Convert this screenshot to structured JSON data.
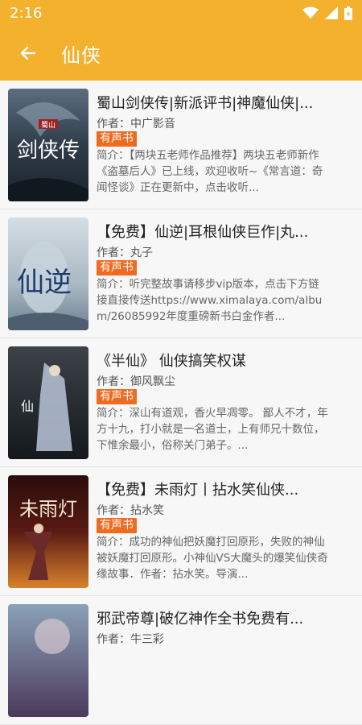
{
  "status": {
    "time": "2:16"
  },
  "header": {
    "title": "仙侠"
  },
  "badge_label": "有声书",
  "items": [
    {
      "title": "蜀山剑侠传|新派评书|神魔仙侠|...",
      "author": "作者：中广影音",
      "desc": "简介：【两块五老师作品推荐】两块五老师新作《盗墓后人》已上线，欢迎收听~《常言道：奇闻怪谈》正在更新中，点击收听...",
      "cover_text": "剑侠传"
    },
    {
      "title": "【免费】仙逆|耳根仙侠巨作|丸...",
      "author": "作者：丸子",
      "desc": "简介：听完整故事请移步vip版本，点击下方链接直接传送https://www.ximalaya.com/album/26085992年度重磅新书白金作者...",
      "cover_text": "仙逆"
    },
    {
      "title": "《半仙》 仙侠搞笑权谋",
      "author": "作者：御风飘尘",
      "desc": "简介：深山有道观，香火早凋零。 鄙人不才，年方十九，打小就是一名道士，上有师兄十数位，下惟余最小，俗称关门弟子。...",
      "cover_text": "仙"
    },
    {
      "title": "【免费】未雨灯丨拈水笑仙侠...",
      "author": "作者：拈水笑",
      "desc": "简介：成功的神仙把妖魔打回原形，失败的神仙被妖魔打回原形。小神仙VS大魔头的爆笑仙侠奇缘故事．作者：拈水笑。导演...",
      "cover_text": "未雨灯"
    },
    {
      "title": "邪武帝尊|破亿神作全书免费有...",
      "author": "作者：牛三彩",
      "desc": "",
      "cover_text": ""
    }
  ]
}
